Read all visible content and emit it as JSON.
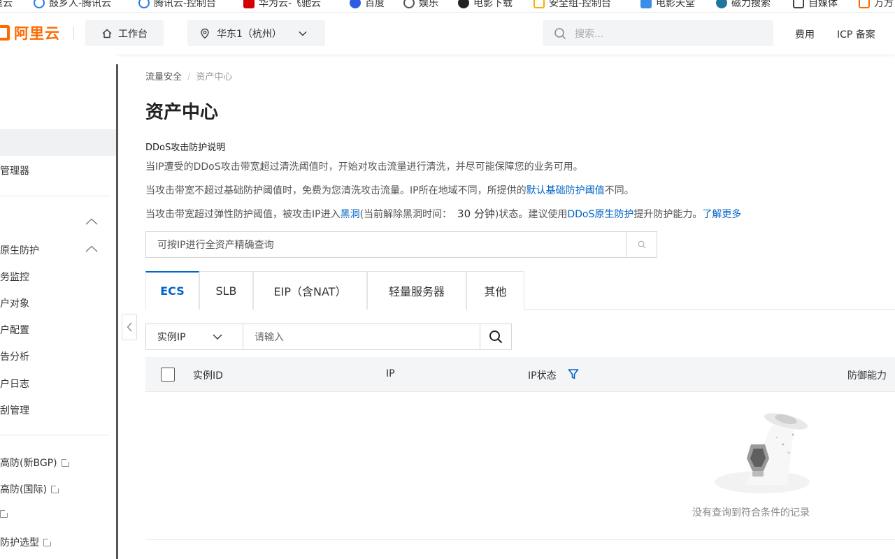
{
  "bookmarks": [
    {
      "label": "里云",
      "color": "#ff6a00"
    },
    {
      "label": "鼓乡人-腾讯云",
      "color": "#2a7ae2"
    },
    {
      "label": "腾讯云-控制台",
      "color": "#2a7ae2"
    },
    {
      "label": "华为云-飞驰云",
      "color": "#d40000"
    },
    {
      "label": "百度",
      "color": "#2d5be3"
    },
    {
      "label": "娱乐",
      "color": "#555555"
    },
    {
      "label": "电影下载",
      "color": "#222222"
    },
    {
      "label": "安全组-控制台",
      "color": "#f0b400"
    },
    {
      "label": "电影天堂",
      "color": "#3a8ee6"
    },
    {
      "label": "磁力搜索",
      "color": "#21759b"
    },
    {
      "label": "自媒体",
      "color": "#444444"
    },
    {
      "label": "万方",
      "color": "#ff6a00"
    }
  ],
  "topnav": {
    "logo": "阿里云",
    "workbench": "工作台",
    "region": "华东1（杭州）",
    "search_placeholder": "搜索...",
    "links": [
      "费用",
      "ICP 备案"
    ]
  },
  "sidebar": {
    "items": [
      {
        "label": "管理器",
        "chevron": false,
        "external": false
      },
      {
        "label": "",
        "chevron": true,
        "external": false
      },
      {
        "label": "原生防护",
        "chevron": true,
        "external": false
      },
      {
        "label": "务监控",
        "chevron": false,
        "external": false
      },
      {
        "label": "户对象",
        "chevron": false,
        "external": false
      },
      {
        "label": "户配置",
        "chevron": false,
        "external": false
      },
      {
        "label": "告分析",
        "chevron": false,
        "external": false
      },
      {
        "label": "户日志",
        "chevron": false,
        "external": false
      },
      {
        "label": "刮管理",
        "chevron": false,
        "external": false
      },
      {
        "label": "高防(新BGP)",
        "chevron": false,
        "external": true
      },
      {
        "label": "高防(国际)",
        "chevron": false,
        "external": true
      },
      {
        "label": "",
        "chevron": false,
        "external": true
      },
      {
        "label": "防护选型",
        "chevron": false,
        "external": true
      }
    ]
  },
  "main": {
    "breadcrumb": [
      "流量安全",
      "资产中心"
    ],
    "title": "资产中心",
    "info_heading": "DDoS攻击防护说明",
    "line1": "当IP遭受的DDoS攻击带宽超过清洗阈值时，开始对攻击流量进行清洗，并尽可能保障您的业务可用。",
    "line2_a": "当攻击带宽不超过基础防护阈值时，免费为您清洗攻击流量。IP所在地域不同，所提供的",
    "line2_link": "默认基础防护阈值",
    "line2_b": "不同。",
    "line3_a": "当攻击带宽超过弹性防护阈值，被攻击IP进入",
    "line3_link1": "黑洞",
    "line3_b": "(当前解除黑洞时间：",
    "line3_num": "30 分钟",
    "line3_c": ")状态。建议使用",
    "line3_link2": "DDoS原生防护",
    "line3_d": "提升防护能力。",
    "line3_link3": "了解更多",
    "global_search_placeholder": "可按IP进行全资产精确查询",
    "tabs": [
      "ECS",
      "SLB",
      "EIP（含NAT）",
      "轻量服务器",
      "其他"
    ],
    "filter": {
      "select": "实例IP",
      "placeholder": "请输入"
    },
    "table": {
      "columns": [
        "实例ID",
        "IP",
        "IP状态",
        "防御能力"
      ]
    },
    "empty_text": "没有查询到符合条件的记录"
  },
  "colors": {
    "accent": "#0064c8",
    "brand": "#ff6a00"
  }
}
